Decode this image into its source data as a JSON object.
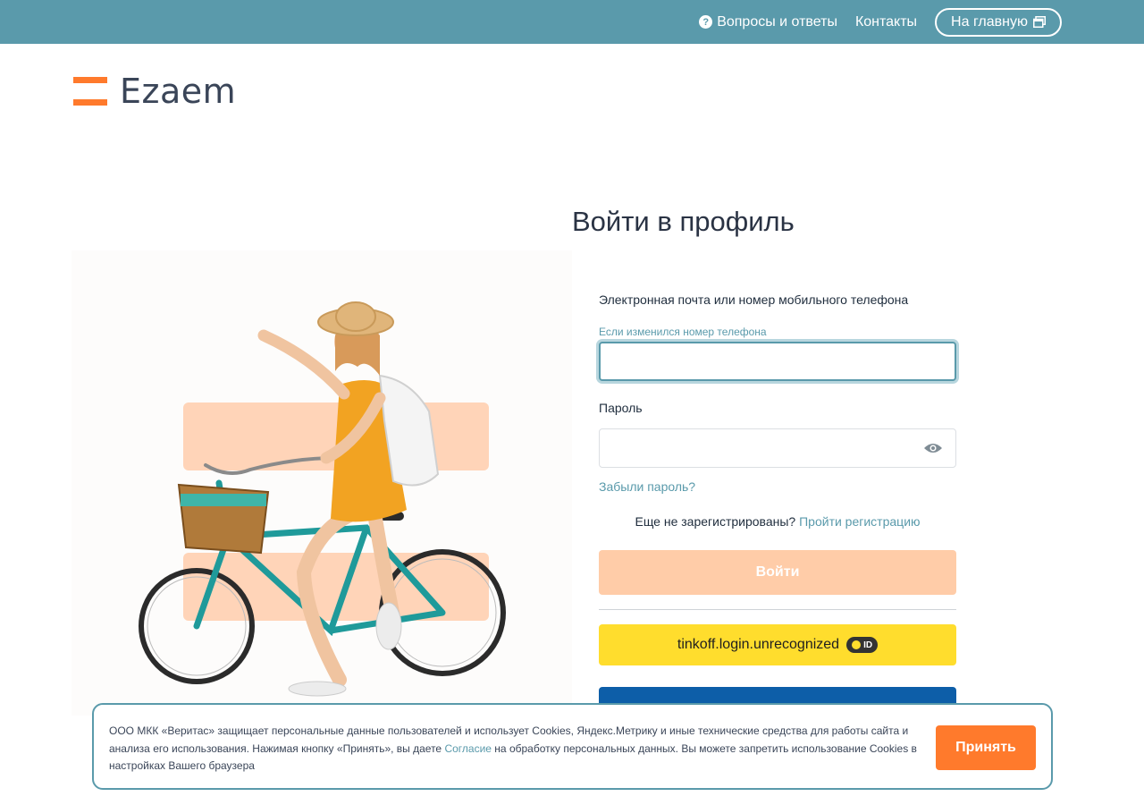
{
  "topbar": {
    "faq_label": "Вопросы и ответы",
    "contacts_label": "Контакты",
    "home_label": "На главную"
  },
  "logo": {
    "text": "Ezaem"
  },
  "form": {
    "title": "Войти в профиль",
    "login_label": "Электронная почта или номер мобильного телефона",
    "phone_changed_hint": "Если изменился номер телефона",
    "login_value": "",
    "password_label": "Пароль",
    "password_value": "",
    "forgot_password": "Забыли пароль?",
    "not_registered": "Еще не зарегистрированы?",
    "register_link": "Пройти регистрацию",
    "submit_label": "Войти",
    "tinkoff_label": "tinkoff.login.unrecognized",
    "tinkoff_badge": "ID"
  },
  "cookie": {
    "text_before": "ООО МКК «Веритас» защищает персональные данные пользователей и использует Cookies, Яндекс.Метрику и иные технические средства для работы сайта и анализа его использования. Нажимая кнопку «Принять», вы даете ",
    "consent_link": "Согласие",
    "text_after": " на обработку персональных данных. Вы можете запретить использование Cookies в настройках Вашего браузера",
    "accept_label": "Принять"
  },
  "colors": {
    "topbar": "#5a9aab",
    "accent": "#ff7a2c",
    "login_button_disabled": "#ffcca8",
    "tinkoff": "#ffdd2d",
    "gosuslugi": "#0d5ea8"
  },
  "icons": [
    "question-circle-icon",
    "window-icon",
    "logo-mark-icon",
    "eye-icon",
    "tinkoff-id-icon"
  ]
}
